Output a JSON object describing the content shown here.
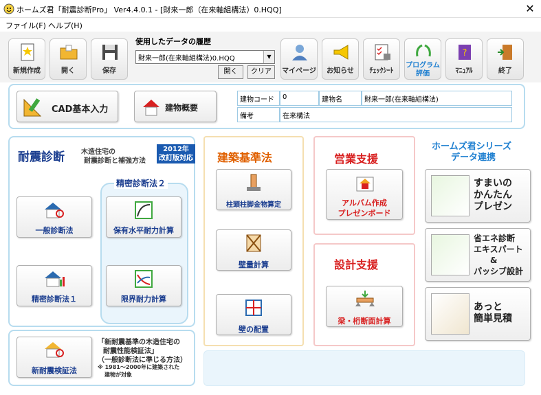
{
  "window": {
    "title": "ホームズ君「耐震診断Pro」 Ver4.4.0.1 - [財来一郎（在来軸組構法）0.HQQ]"
  },
  "menu": {
    "file": "ファイル(F)",
    "help": "ヘルプ(H)"
  },
  "toolbar": {
    "new": "新規作成",
    "open": "開く",
    "save": "保存",
    "history_label": "使用したデータの履歴",
    "history_value": "財来一郎(在来軸組構法)0.HQQ",
    "history_open": "開く",
    "history_clear": "クリア",
    "mypage": "マイページ",
    "notice": "お知らせ",
    "checksheet": "ﾁｪｯｸｼｰﾄ",
    "program_eval_1": "プログラム",
    "program_eval_2": "評価",
    "manual": "ﾏﾆｭｱﾙ",
    "exit": "終了"
  },
  "building": {
    "cad_button": "CAD基本入力",
    "overview_button": "建物概要",
    "code_label": "建物コード",
    "code_value": "0",
    "name_label": "建物名",
    "name_value": "財来一郎(在来軸組構法)",
    "note_label": "備考",
    "note_value": "在来構法"
  },
  "seismic": {
    "title": "耐震診断",
    "desc1": "木造住宅の",
    "desc2": "耐震診断と補強方法",
    "badge1": "2012年",
    "badge2": "改訂版対応",
    "precision2_title": "精密診断法２",
    "general": "一般診断法",
    "precision1": "精密診断法１",
    "horizontal": "保有水平耐力計算",
    "limit": "限界耐力計算"
  },
  "new_seismic": {
    "button": "新耐震検証法",
    "line1": "「新耐震基準の木造住宅の",
    "line2": "耐震性能検証法」",
    "line3": "（一般診断法に準じる方法）",
    "line4": "※ 1981～2000年に建築された",
    "line5": "建物が対象"
  },
  "building_code": {
    "title": "建築基準法",
    "column": "柱頭柱脚金物算定",
    "wall": "壁量計算",
    "layout": "壁の配置"
  },
  "sales": {
    "title": "営業支援",
    "album1": "アルバム作成",
    "album2": "プレゼンボード"
  },
  "design": {
    "title": "設計支援",
    "beam": "梁・桁断面計算"
  },
  "series": {
    "title1": "ホームズ君シリーズ",
    "title2": "データ連携",
    "p1": "すまいの\nかんたん\nプレゼン",
    "p2": "省エネ診断\nエキスパート\n　　&\nパッシブ設計",
    "p3": "あっと\n簡単見積"
  },
  "colors": {
    "accent_blue": "#1a3d8f",
    "orange": "#e06000",
    "red": "#d82020",
    "panel_border": "#b7dcef"
  }
}
